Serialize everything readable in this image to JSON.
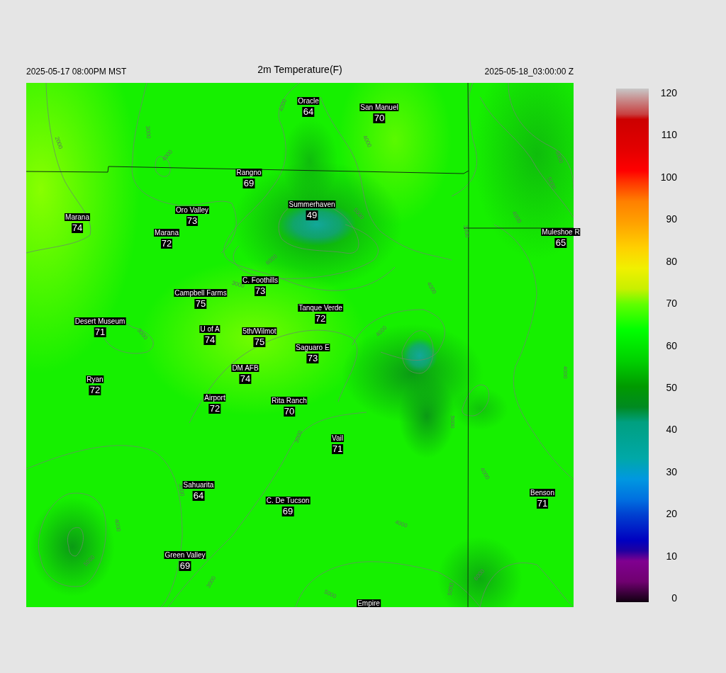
{
  "header": {
    "valid_time_local": "2025-05-17 08:00PM MST",
    "title": "2m Temperature(F)",
    "valid_time_utc": "2025-05-18_03:00:00 Z"
  },
  "stations": [
    {
      "name": "Oracle",
      "value": "64"
    },
    {
      "name": "San Manuel",
      "value": "70"
    },
    {
      "name": "Rangno",
      "value": "69"
    },
    {
      "name": "Summerhaven",
      "value": "49"
    },
    {
      "name": "Marana",
      "value": "74"
    },
    {
      "name": "Oro Valley",
      "value": "73"
    },
    {
      "name": "Marana",
      "value": "72"
    },
    {
      "name": "Muleshoe R",
      "value": "65"
    },
    {
      "name": "C. Foothills",
      "value": "73"
    },
    {
      "name": "Campbell Farms",
      "value": "75"
    },
    {
      "name": "Tanque Verde",
      "value": "72"
    },
    {
      "name": "Desert Museum",
      "value": "71"
    },
    {
      "name": "U of A",
      "value": "74"
    },
    {
      "name": "5th/Wilmot",
      "value": "75"
    },
    {
      "name": "Saguaro E",
      "value": "73"
    },
    {
      "name": "DM AFB",
      "value": "74"
    },
    {
      "name": "Ryan",
      "value": "72"
    },
    {
      "name": "Airport",
      "value": "72"
    },
    {
      "name": "Rita Ranch",
      "value": "70"
    },
    {
      "name": "Vail",
      "value": "71"
    },
    {
      "name": "Sahuarita",
      "value": "64"
    },
    {
      "name": "C. De Tucson",
      "value": "69"
    },
    {
      "name": "Benson",
      "value": "71"
    },
    {
      "name": "Green Valley",
      "value": "69"
    },
    {
      "name": "Empire"
    }
  ],
  "contour_labels": [
    "2000",
    "3000",
    "4000",
    "4000",
    "4000",
    "6000",
    "5000",
    "4000",
    "3000",
    "5000",
    "6000",
    "3000",
    "3000",
    "4000",
    "4000",
    "5000",
    "4000",
    "4000",
    "3000",
    "3000",
    "4000",
    "5000",
    "3000",
    "4000",
    "5000",
    "5000",
    "6000"
  ],
  "colorbar": {
    "ticks": [
      "120",
      "110",
      "100",
      "90",
      "80",
      "70",
      "60",
      "50",
      "40",
      "30",
      "20",
      "10",
      "0"
    ]
  }
}
